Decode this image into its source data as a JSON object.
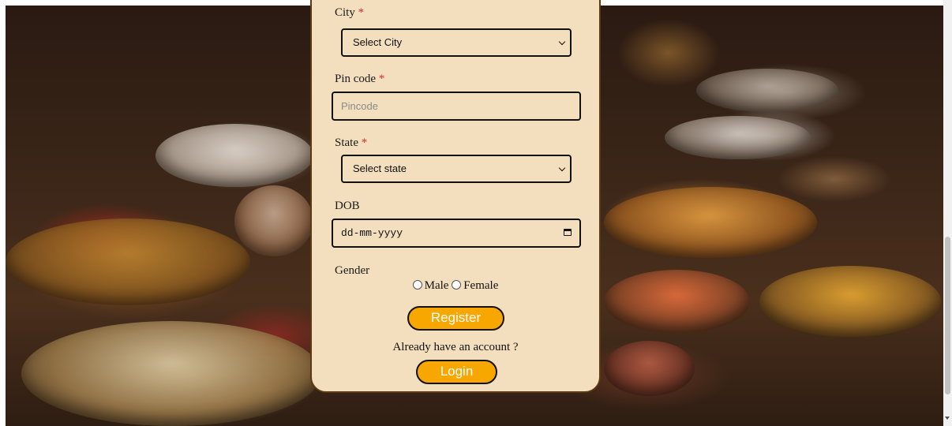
{
  "form": {
    "city": {
      "label": "City",
      "required_mark": "*",
      "selected": "Select City"
    },
    "pincode": {
      "label": "Pin code",
      "required_mark": "*",
      "placeholder": "Pincode"
    },
    "state": {
      "label": "State",
      "required_mark": "*",
      "selected": "Select state"
    },
    "dob": {
      "label": "DOB",
      "placeholder": "dd-mm-yyyy"
    },
    "gender": {
      "label": "Gender",
      "options": [
        "Male",
        "Female"
      ]
    },
    "register_label": "Register",
    "account_prompt": "Already have an account ?",
    "login_label": "Login"
  },
  "colors": {
    "card_background": "#f3dfbd",
    "button_background": "#f7a700",
    "required_mark": "#d03030"
  }
}
